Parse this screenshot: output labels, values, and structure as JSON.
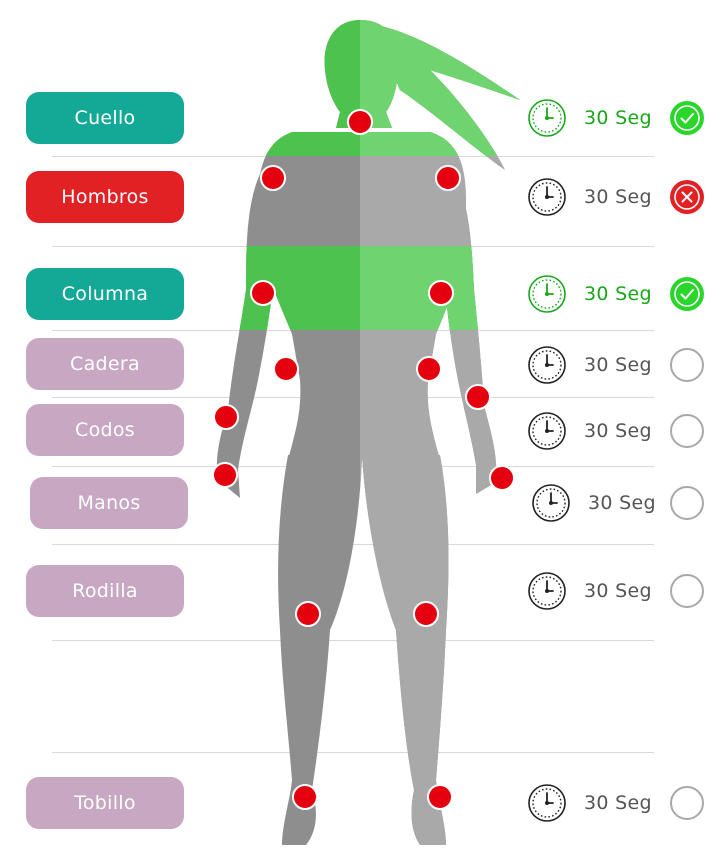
{
  "colors": {
    "teal": "#14a997",
    "red": "#e12124",
    "lilac": "#c8a7c2",
    "body_gray": "#8e8e8e",
    "body_green": "#4ec24e",
    "marker_red": "#e5000f",
    "done_green": "#2bd62b",
    "timer_green": "#19a81a"
  },
  "exercises": [
    {
      "label": "Cuello",
      "style": "teal",
      "timer": "30 Seg",
      "status": "completed",
      "clock": "clock-icon-green"
    },
    {
      "label": "Hombros",
      "style": "red",
      "timer": "30 Seg",
      "status": "failed",
      "clock": "clock-icon"
    },
    {
      "label": "Columna",
      "style": "teal",
      "timer": "30 Seg",
      "status": "completed",
      "clock": "clock-icon-green"
    },
    {
      "label": "Cadera",
      "style": "lilac",
      "timer": "30 Seg",
      "status": "pending",
      "clock": "clock-icon"
    },
    {
      "label": "Codos",
      "style": "lilac",
      "timer": "30 Seg",
      "status": "pending",
      "clock": "clock-icon"
    },
    {
      "label": "Manos",
      "style": "lilac",
      "timer": "30 Seg",
      "status": "pending",
      "clock": "clock-icon"
    },
    {
      "label": "Rodilla",
      "style": "lilac",
      "timer": "30 Seg",
      "status": "pending",
      "clock": "clock-icon"
    },
    {
      "label": "Tobillo",
      "style": "lilac",
      "timer": "30 Seg",
      "status": "pending",
      "clock": "clock-icon"
    }
  ],
  "joint_markers": [
    "neck",
    "left-shoulder",
    "right-shoulder",
    "left-elbow",
    "right-elbow",
    "left-hip",
    "right-hip",
    "left-wrist",
    "right-wrist",
    "left-hand",
    "right-hand",
    "left-knee",
    "right-knee",
    "left-ankle",
    "right-ankle"
  ]
}
